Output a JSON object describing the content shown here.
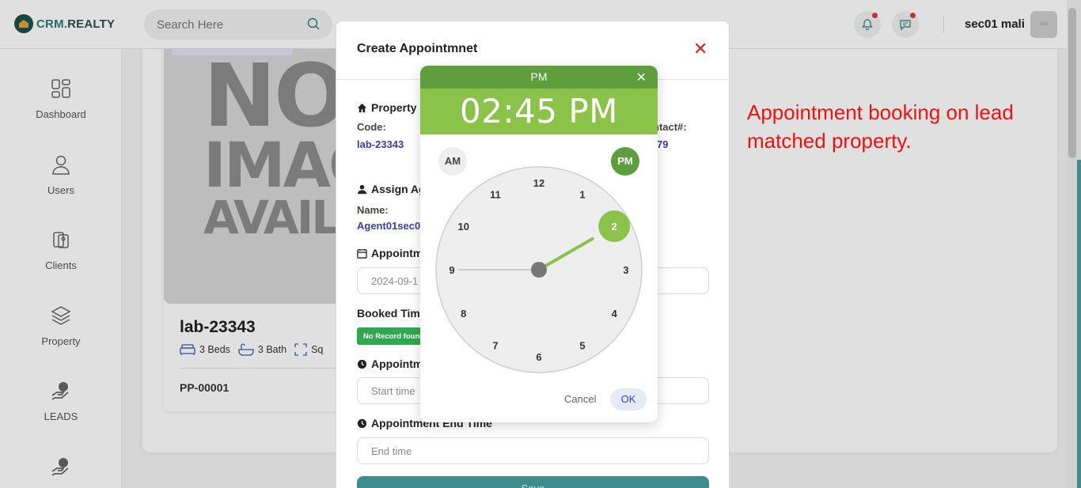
{
  "app": {
    "logo_prefix": "CRM.",
    "logo_suffix": "REALTY"
  },
  "search": {
    "placeholder": "Search Here"
  },
  "user": {
    "name": "sec01 mali",
    "avatar_text": "dom"
  },
  "sidebar": {
    "items": [
      {
        "label": "Dashboard",
        "icon": "dashboard-icon"
      },
      {
        "label": "Users",
        "icon": "user-icon"
      },
      {
        "label": "Clients",
        "icon": "clients-icon"
      },
      {
        "label": "Property",
        "icon": "layers-icon"
      },
      {
        "label": "LEADS",
        "icon": "hand-coin-icon"
      }
    ]
  },
  "property_card": {
    "image_text": [
      "NO",
      "IMAGE",
      "AVAILABLE"
    ],
    "title": "lab-23343",
    "beds": "3 Beds",
    "baths": "3 Bath",
    "sqft": "Sq",
    "code": "PP-00001"
  },
  "modal": {
    "title": "Create Appointmnet",
    "property_heading": "Property",
    "code_label": "Code:",
    "code_value": "lab-23343",
    "contact_label": "ntact#:",
    "contact_value": "79",
    "assign_heading": "Assign Ag",
    "name_label": "Name:",
    "name_value": "Agent01sec0",
    "date_heading": "Appointm",
    "date_value": "2024-09-1",
    "booked_label": "Booked Time",
    "no_record": "No Record found",
    "start_heading": "Appointm",
    "start_placeholder": "Start time",
    "end_heading": "Appointment End Time",
    "end_placeholder": "End time",
    "save_label": "Save"
  },
  "time_picker": {
    "period_header": "PM",
    "time_display": "02:45 PM",
    "am_label": "AM",
    "pm_label": "PM",
    "selected_hour": 2,
    "hours": [
      "12",
      "1",
      "2",
      "3",
      "4",
      "5",
      "6",
      "7",
      "8",
      "9",
      "10",
      "11"
    ],
    "cancel_label": "Cancel",
    "ok_label": "OK",
    "accent_color": "#8bc34a",
    "header_color": "#5f9e3c"
  },
  "annotation": {
    "text": "Appointment booking on lead matched property."
  }
}
